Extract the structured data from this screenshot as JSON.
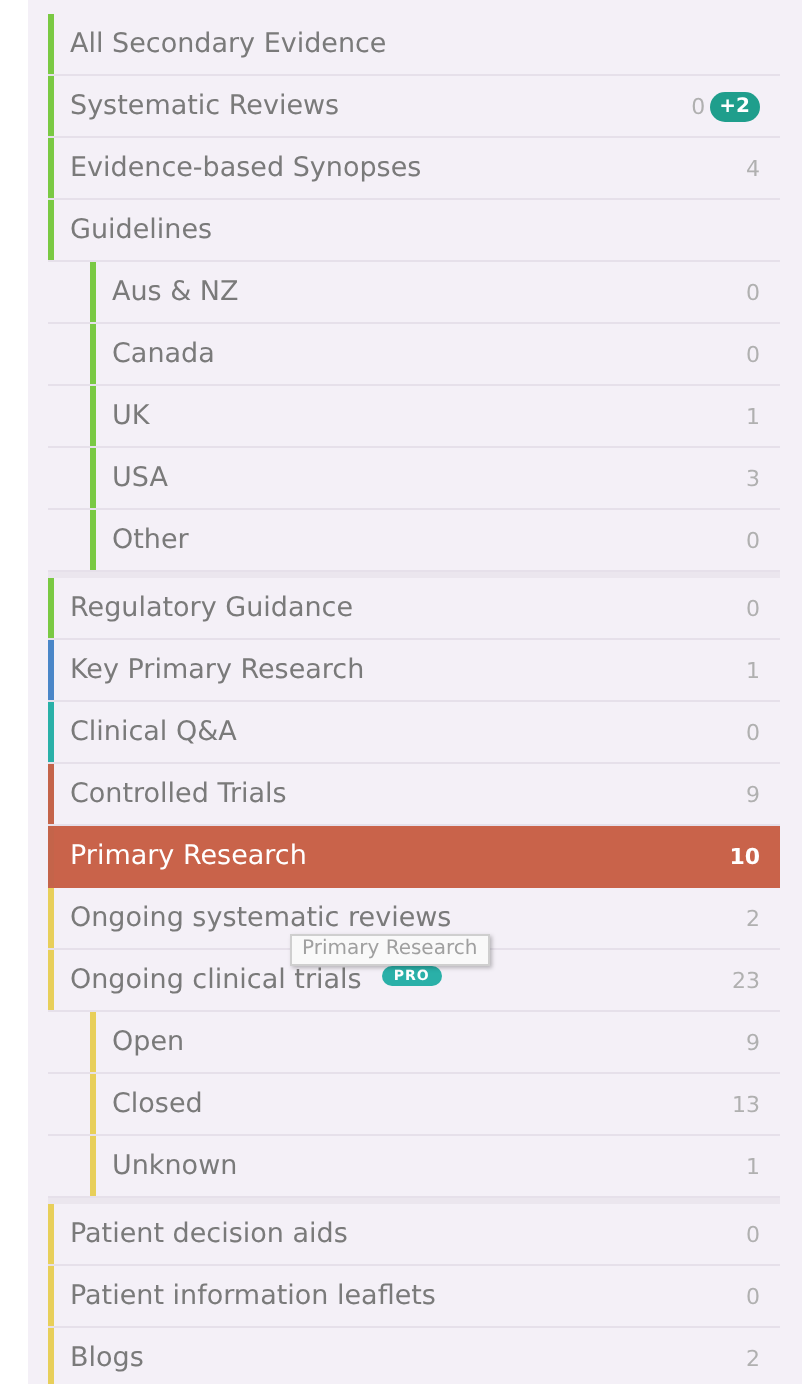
{
  "items": [
    {
      "label": "All Secondary Evidence",
      "color": "#7ac943",
      "selected": false
    },
    {
      "label": "Systematic Reviews",
      "count": "0",
      "badge": "+2",
      "color": "#7ac943",
      "selected": false
    },
    {
      "label": "Evidence-based Synopses",
      "count": "4",
      "color": "#7ac943",
      "selected": false
    },
    {
      "label": "Guidelines",
      "color": "#7ac943",
      "selected": false,
      "children": [
        {
          "label": "Aus & NZ",
          "count": "0",
          "color": "#7ac943",
          "selected": false
        },
        {
          "label": "Canada",
          "count": "0",
          "color": "#7ac943",
          "selected": false
        },
        {
          "label": "UK",
          "count": "1",
          "color": "#7ac943",
          "selected": false
        },
        {
          "label": "USA",
          "count": "3",
          "color": "#7ac943",
          "selected": false
        },
        {
          "label": "Other",
          "count": "0",
          "color": "#7ac943",
          "selected": false
        }
      ]
    },
    {
      "label": "Regulatory Guidance",
      "count": "0",
      "color": "#7ac943",
      "selected": false
    },
    {
      "label": "Key Primary Research",
      "count": "1",
      "color": "#4a86c8",
      "selected": false
    },
    {
      "label": "Clinical Q&A",
      "count": "0",
      "color": "#2ab0a8",
      "selected": false
    },
    {
      "label": "Controlled Trials",
      "count": "9",
      "color": "#c4644a",
      "selected": false
    },
    {
      "label": "Primary Research",
      "count": "10",
      "color": "#c4644a",
      "selected": true
    },
    {
      "label": "Ongoing systematic reviews",
      "count": "2",
      "color": "#e8cf5a",
      "selected": false
    },
    {
      "label": "Ongoing clinical trials",
      "tag": "PRO",
      "count": "23",
      "color": "#e8cf5a",
      "selected": false,
      "children": [
        {
          "label": "Open",
          "count": "9",
          "color": "#e8cf5a",
          "selected": false
        },
        {
          "label": "Closed",
          "count": "13",
          "color": "#e8cf5a",
          "selected": false
        },
        {
          "label": "Unknown",
          "count": "1",
          "color": "#e8cf5a",
          "selected": false
        }
      ]
    },
    {
      "label": "Patient decision aids",
      "count": "0",
      "color": "#e8cf5a",
      "selected": false
    },
    {
      "label": "Patient information leaflets",
      "count": "0",
      "color": "#e8cf5a",
      "selected": false
    },
    {
      "label": "Blogs",
      "count": "2",
      "color": "#e8cf5a",
      "selected": false
    }
  ],
  "tooltip": {
    "text": "Primary Research"
  }
}
